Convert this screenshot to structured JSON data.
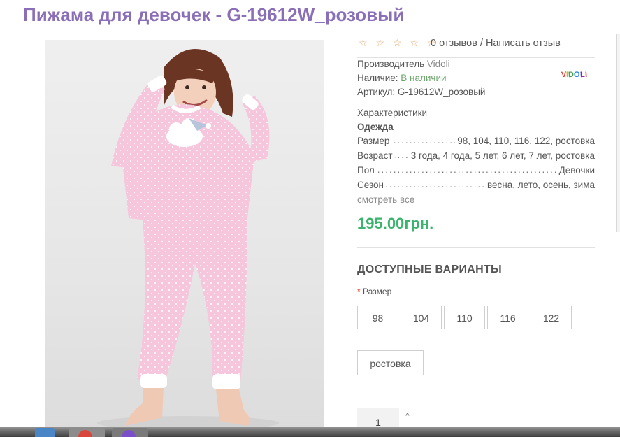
{
  "product": {
    "title": "Пижама для девочек - G-19612W_розовый",
    "photo_alt": "Пижама для девочек розовая"
  },
  "rating": {
    "stars": "☆ ☆ ☆ ☆ ☆",
    "reviews_text": "0 отзывов",
    "separator": " / ",
    "write_review": "Написать отзыв"
  },
  "details": {
    "manufacturer_label": "Производитель",
    "manufacturer_value": "Vidoli",
    "availability_label": "Наличие:",
    "availability_value": "В наличии",
    "sku_label": "Артикул:",
    "sku_value": "G-19612W_розовый",
    "brand_logo_text": "VIDOLI"
  },
  "characteristics": {
    "heading": "Характеристики",
    "group": "Одежда",
    "rows": [
      {
        "key": "Размер",
        "value": "98, 104, 110, 116, 122, ростовка"
      },
      {
        "key": "Возраст",
        "value": "3 года, 4 года, 5 лет, 6 лет, 7 лет, ростовка"
      },
      {
        "key": "Пол",
        "value": "Девочки"
      },
      {
        "key": "Сезон",
        "value": "весна, лето, осень, зима"
      }
    ],
    "show_all": "смотреть все"
  },
  "price": "195.00грн.",
  "variants": {
    "heading": "ДОСТУПНЫЕ ВАРИАНТЫ",
    "required_mark": "*",
    "size_label": "Размер",
    "sizes": [
      "98",
      "104",
      "110",
      "116",
      "122"
    ],
    "extra": "ростовка"
  },
  "quantity": {
    "value": "1",
    "up_icon": "^"
  },
  "colors": {
    "title": "#8a6fb8",
    "price": "#3bb46e",
    "availability": "#6aa56a",
    "stars": "#e0a56a"
  }
}
